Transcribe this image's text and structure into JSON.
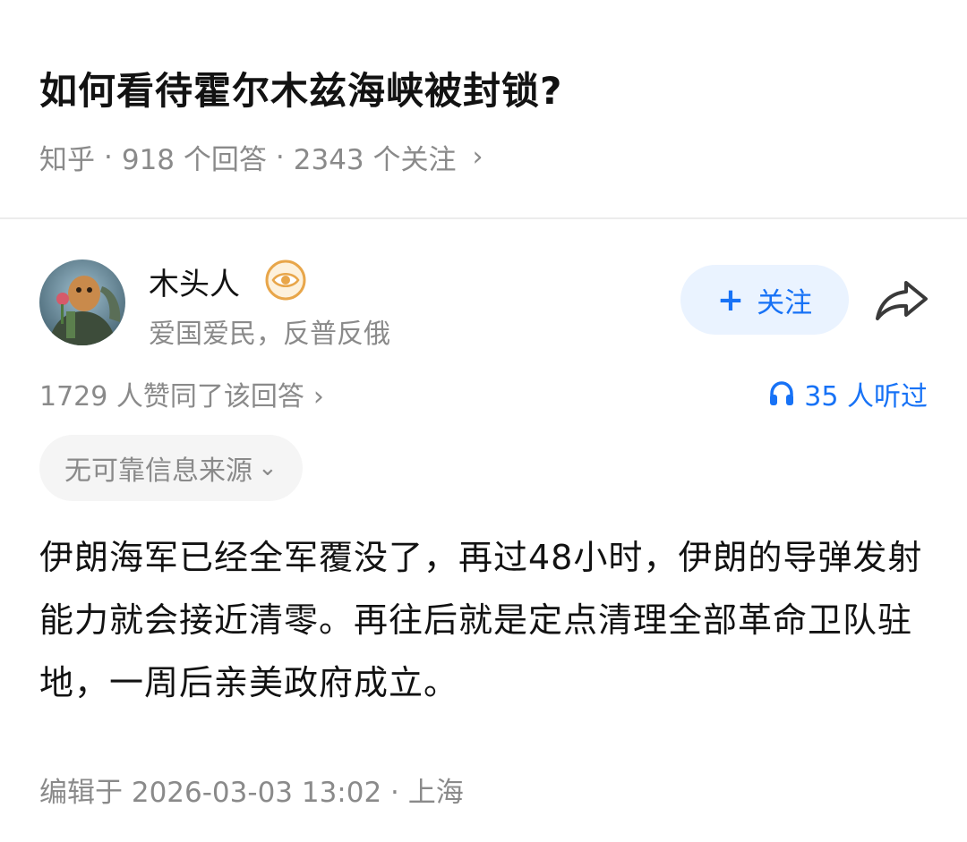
{
  "question": {
    "title": "如何看待霍尔木兹海峡被封锁?",
    "source": "知乎",
    "separator": "·",
    "answers": "918 个回答",
    "followers": "2343 个关注",
    "chevron": "›"
  },
  "author": {
    "name": "木头人",
    "bio": "爱国爱民，反普反俄",
    "badge_icon": "eye-badge-icon",
    "avatar_icon": "avatar-image"
  },
  "actions": {
    "follow_plus": "+",
    "follow_label": "关注",
    "share_icon": "share-arrow-icon"
  },
  "stats": {
    "votes": "1729 人赞同了该回答",
    "votes_chevron": "›",
    "listeners": "35 人听过",
    "listeners_icon": "headphones-icon"
  },
  "source_tag": {
    "label": "无可靠信息来源",
    "chevron": "⌄"
  },
  "answer": {
    "body": "伊朗海军已经全军覆没了，再过48小时，伊朗的导弹发射能力就会接近清零。再往后就是定点清理全部革命卫队驻地，一周后亲美政府成立。"
  },
  "footer": {
    "edited": "编辑于 2026-03-03 13:02 · 上海"
  },
  "colors": {
    "primary": "#1772f6",
    "follow_bg": "#eaf3ff",
    "text": "#121212",
    "muted": "#8a8a8a",
    "badge": "#e8a64a"
  }
}
